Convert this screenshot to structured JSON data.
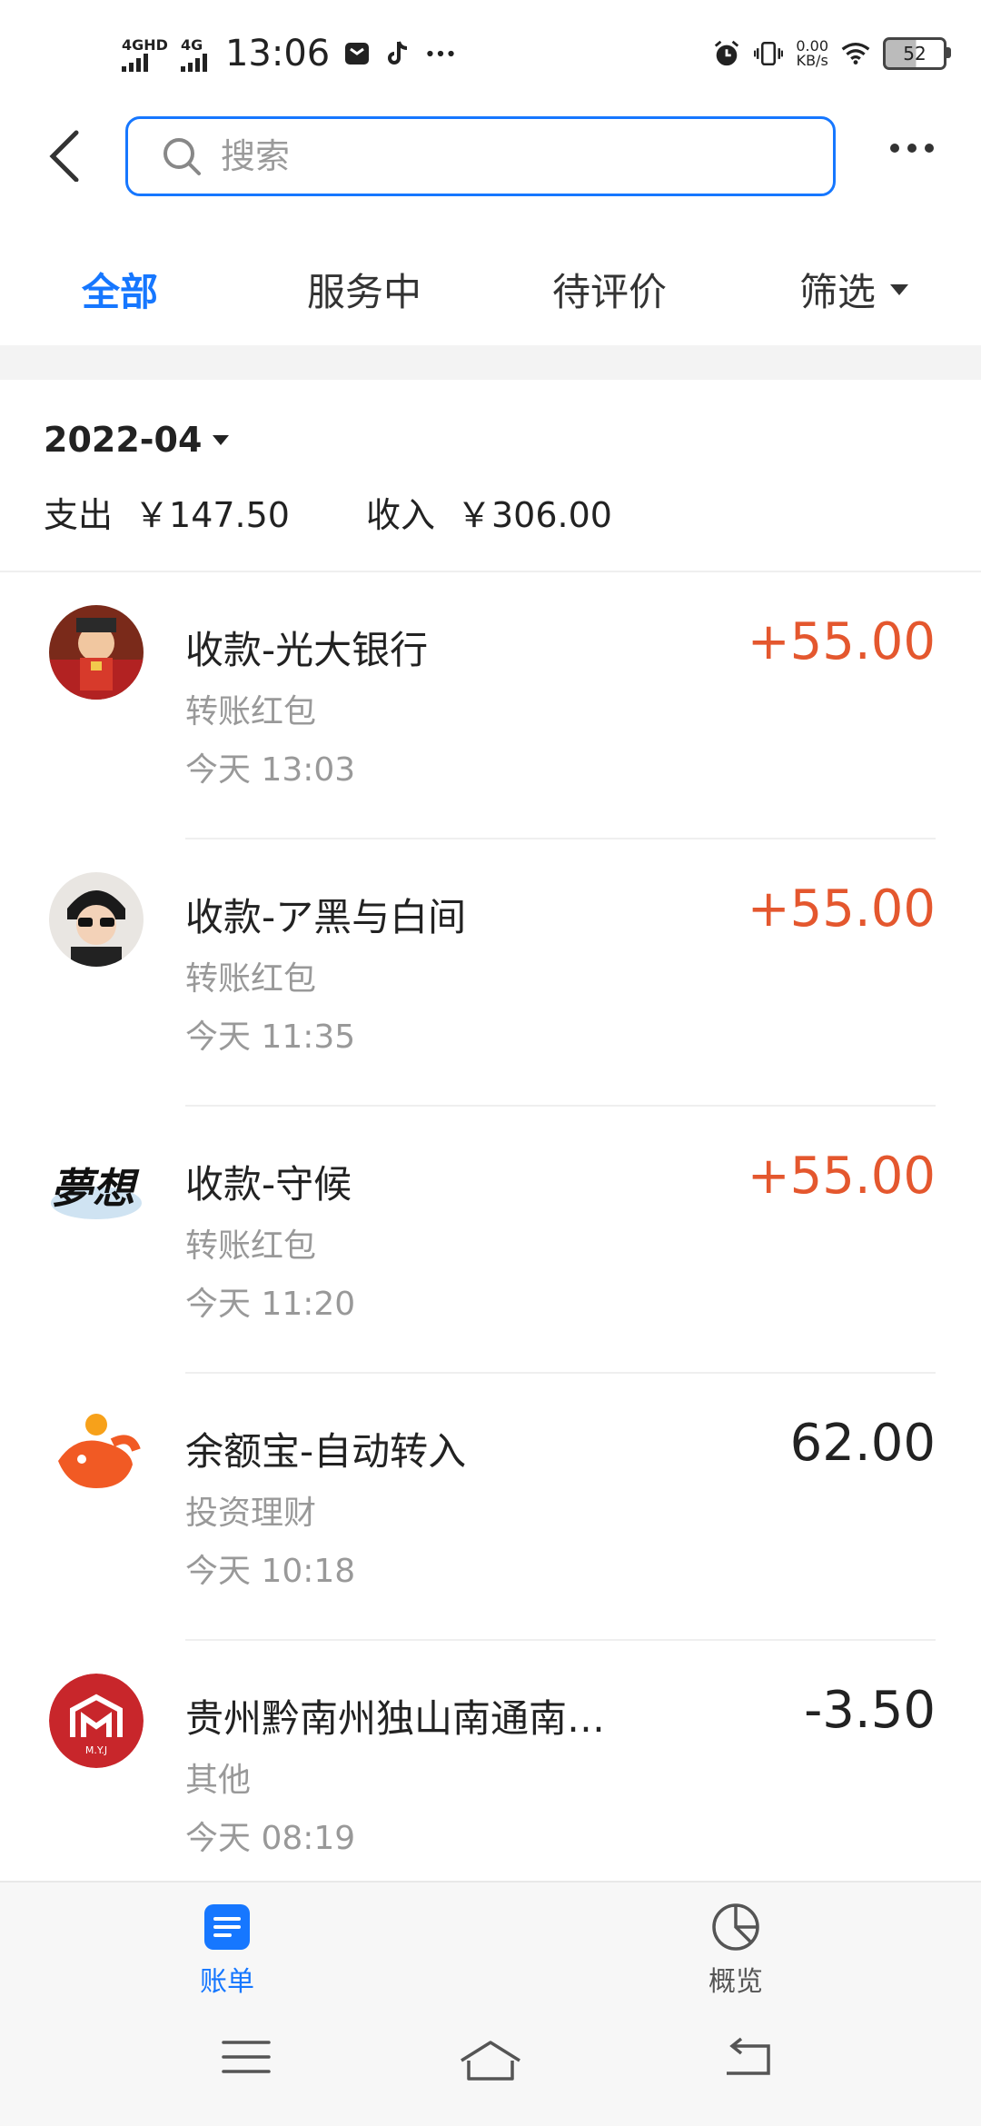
{
  "status_bar": {
    "network1": "4GHD",
    "network2": "4G",
    "time": "13:06",
    "speed_value": "0.00",
    "speed_unit": "KB/s",
    "battery": "52"
  },
  "search": {
    "placeholder": "搜索"
  },
  "tabs": [
    {
      "label": "全部",
      "active": true
    },
    {
      "label": "服务中",
      "active": false
    },
    {
      "label": "待评价",
      "active": false
    }
  ],
  "filter_label": "筛选",
  "month": "2022-04",
  "summary": {
    "expense_label": "支出",
    "expense_value": "￥147.50",
    "income_label": "收入",
    "income_value": "￥306.00"
  },
  "transactions": [
    {
      "title": "收款-光大银行",
      "category": "转账红包",
      "time": "今天  13:03",
      "amount": "+55.00",
      "type": "in"
    },
    {
      "title": "收款-ア黑与白间",
      "category": "转账红包",
      "time": "今天  11:35",
      "amount": "+55.00",
      "type": "in"
    },
    {
      "title": "收款-守候",
      "category": "转账红包",
      "time": "今天  11:20",
      "amount": "+55.00",
      "type": "in"
    },
    {
      "title": "余额宝-自动转入",
      "category": "投资理财",
      "time": "今天  10:18",
      "amount": "62.00",
      "type": "neutral"
    },
    {
      "title": "贵州黔南州独山南通南…",
      "category": "其他",
      "time": "今天  08:19",
      "amount": "-3.50",
      "type": "neutral"
    }
  ],
  "avatar_text": {
    "tx2": "夢想",
    "tx4": "M.Y.J"
  },
  "bottom_nav": [
    {
      "label": "账单",
      "icon": "bill-icon",
      "active": true
    },
    {
      "label": "概览",
      "icon": "pie-chart-icon",
      "active": false
    }
  ],
  "colors": {
    "accent": "#1677ff",
    "income": "#e4572e"
  }
}
